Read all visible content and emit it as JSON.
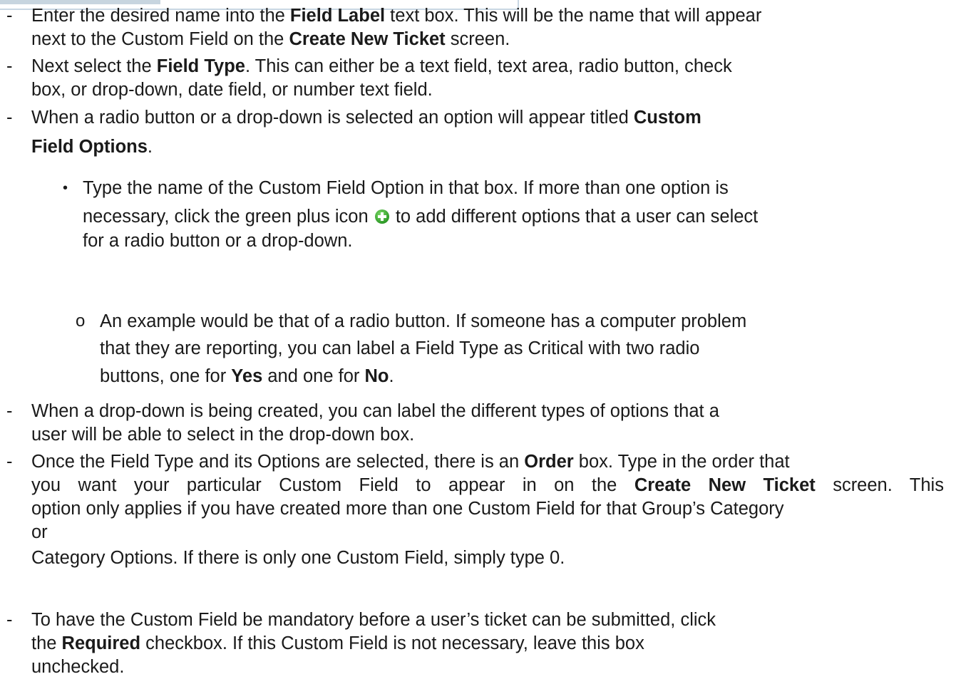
{
  "item1": {
    "dash": "-",
    "s1": "Enter the desired name into the ",
    "b1": "Field Label",
    "s2": " text box. This will be the name that will appear",
    "s3": "next to the Custom Field on the ",
    "b2": "Create New Ticket",
    "s4": " screen."
  },
  "item2": {
    "dash": "-",
    "s1": "Next select the ",
    "b1": "Field Type",
    "s2": ". This can either be a text field, text area, radio button, check",
    "s3": "box, or drop-down, date field, or number text field."
  },
  "item3": {
    "dash": "-",
    "s1": "When a radio button or a drop-down is selected an option will appear titled ",
    "b1": "Custom",
    "b2": "Field Options",
    "s2": "."
  },
  "bullet1": {
    "mark": "•",
    "s1": "Type the name of the Custom Field Option in that box. If more than one option is",
    "s2": "necessary, click the green plus icon ",
    "icon": "green-plus-icon",
    "s3": " to add different options that a user can select",
    "s4": "for a radio button or a drop-down."
  },
  "sub1": {
    "mark": "o",
    "s1": "An example would be that of a radio button. If someone has a computer problem",
    "s2": "that they are reporting, you can label a Field Type as Critical with two radio",
    "s3": "buttons, one for ",
    "b1": "Yes",
    "s4": " and one for ",
    "b2": "No",
    "s5": "."
  },
  "item4": {
    "dash": "-",
    "s1": "When a drop-down is being created, you can label the different types of options that a",
    "s2": "user will be able to select in the drop-down box."
  },
  "item5": {
    "dash": "-",
    "s1": "Once the Field Type and its Options are selected, there is an ",
    "b1": "Order",
    "s2": " box. Type in the order that",
    "s3": "you want your particular Custom Field to appear in on the ",
    "b2": "Create New Ticket",
    "s4": " screen. This",
    "s5": "option only applies if you have created more than one Custom Field for that Group’s Category",
    "s6": "or",
    "s7": "Category Options. If there is only one Custom Field, simply type 0."
  },
  "item6": {
    "dash": "-",
    "s1": "To have the Custom Field be mandatory before a user’s ticket can be submitted, click",
    "s2": "the ",
    "b1": "Required",
    "s3": " checkbox. If this Custom Field is not necessary, leave this box",
    "s4": "unchecked."
  }
}
